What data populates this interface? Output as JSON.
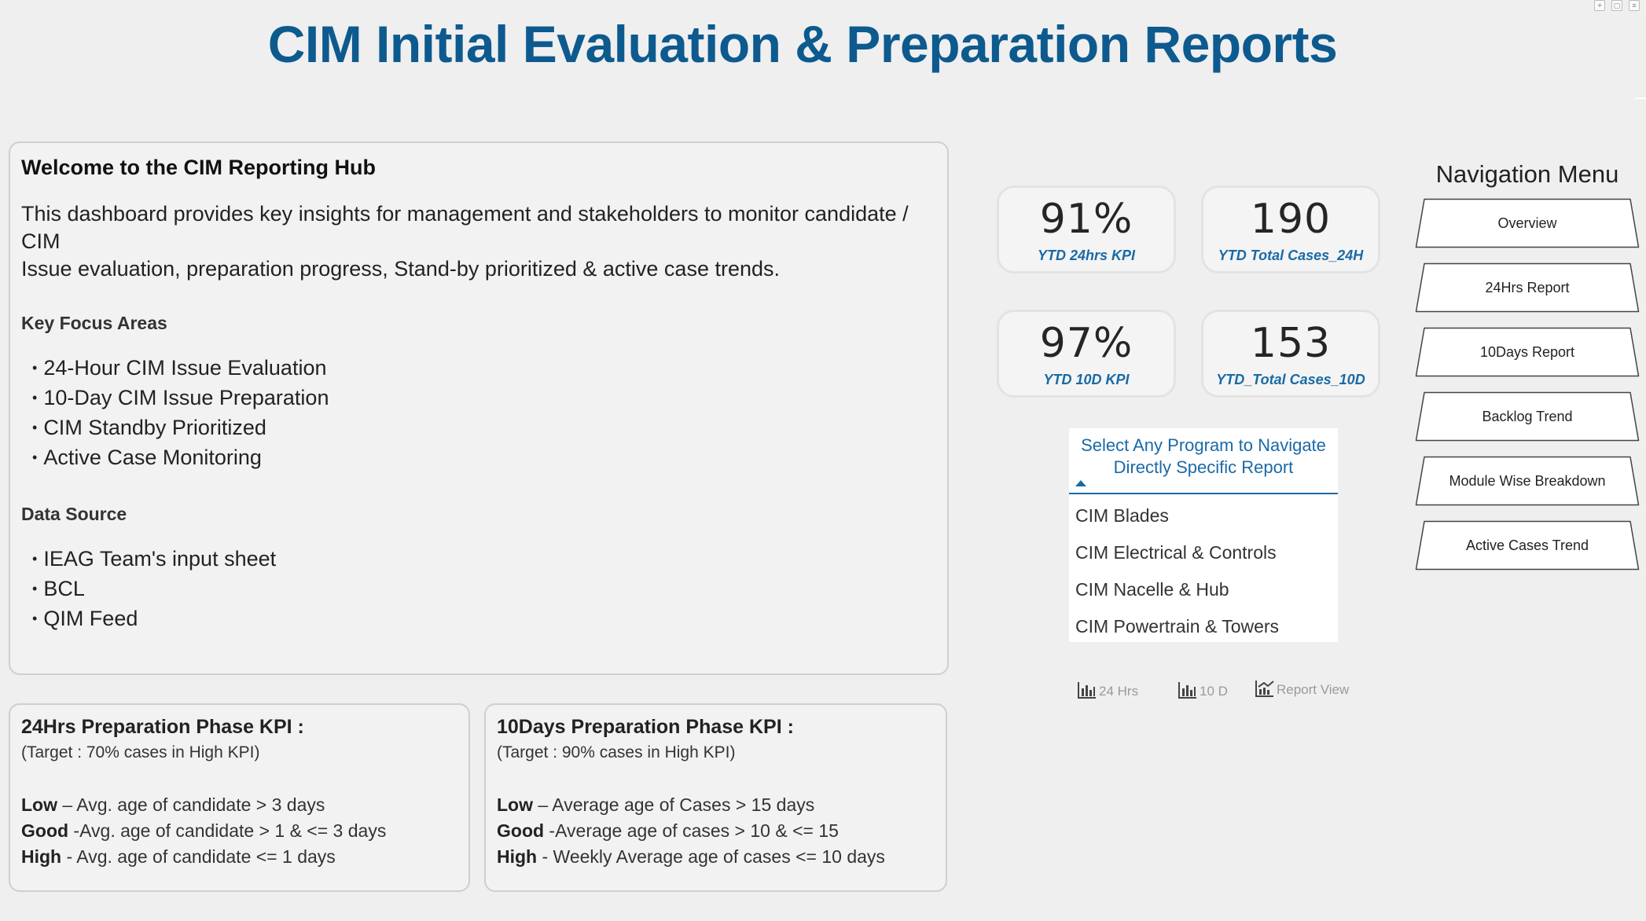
{
  "title": "CIM Initial Evaluation & Preparation Reports",
  "welcome": {
    "heading": "Welcome to the CIM Reporting Hub",
    "intro_line1": "This dashboard provides key insights for management and stakeholders to monitor candidate / CIM",
    "intro_line2": "Issue evaluation, preparation progress, Stand-by prioritized & active case trends.",
    "focus_heading": "Key Focus Areas",
    "focus_items": [
      "24-Hour CIM Issue Evaluation",
      "10-Day CIM Issue Preparation",
      "CIM Standby Prioritized",
      "Active Case Monitoring"
    ],
    "source_heading": "Data Source",
    "source_items": [
      "IEAG Team's input sheet",
      "BCL",
      "QIM Feed"
    ]
  },
  "kpi24": {
    "heading": "24Hrs Preparation Phase KPI :",
    "target": "(Target : 70% cases in High KPI)",
    "low_label": "Low",
    "low_text": " – Avg. age of candidate > 3 days",
    "good_label": "Good",
    "good_text": " -Avg. age of candidate > 1 & <= 3 days",
    "high_label": "High",
    "high_text": " - Avg. age of candidate <= 1 days"
  },
  "kpi10": {
    "heading": "10Days Preparation Phase KPI :",
    "target": "(Target : 90% cases in High KPI)",
    "low_label": "Low",
    "low_text": " – Average age of Cases > 15 days",
    "good_label": "Good",
    "good_text": " -Average age of cases > 10 & <= 15",
    "high_label": "High",
    "high_text": " - Weekly Average age of cases <= 10 days"
  },
  "stats": [
    {
      "value": "91%",
      "label": "YTD 24hrs KPI"
    },
    {
      "value": "190",
      "label": "YTD Total Cases_24H"
    },
    {
      "value": "97%",
      "label": "YTD 10D KPI"
    },
    {
      "value": "153",
      "label": "YTD_Total Cases_10D"
    }
  ],
  "selector": {
    "header": "Select Any Program to Navigate Directly Specific Report",
    "options": [
      "CIM Blades",
      "CIM Electrical & Controls",
      "CIM Nacelle & Hub",
      "CIM Powertrain & Towers"
    ]
  },
  "report_buttons": [
    "24 Hrs",
    "10 D",
    "Report View"
  ],
  "nav": {
    "title": "Navigation Menu",
    "items": [
      "Overview",
      "24Hrs Report",
      "10Days Report",
      "Backlog Trend",
      "Module Wise Breakdown",
      "Active Cases Trend"
    ]
  },
  "colors": {
    "title": "#0d5a8f",
    "accent": "#1a6aa6",
    "background": "#efefef"
  }
}
